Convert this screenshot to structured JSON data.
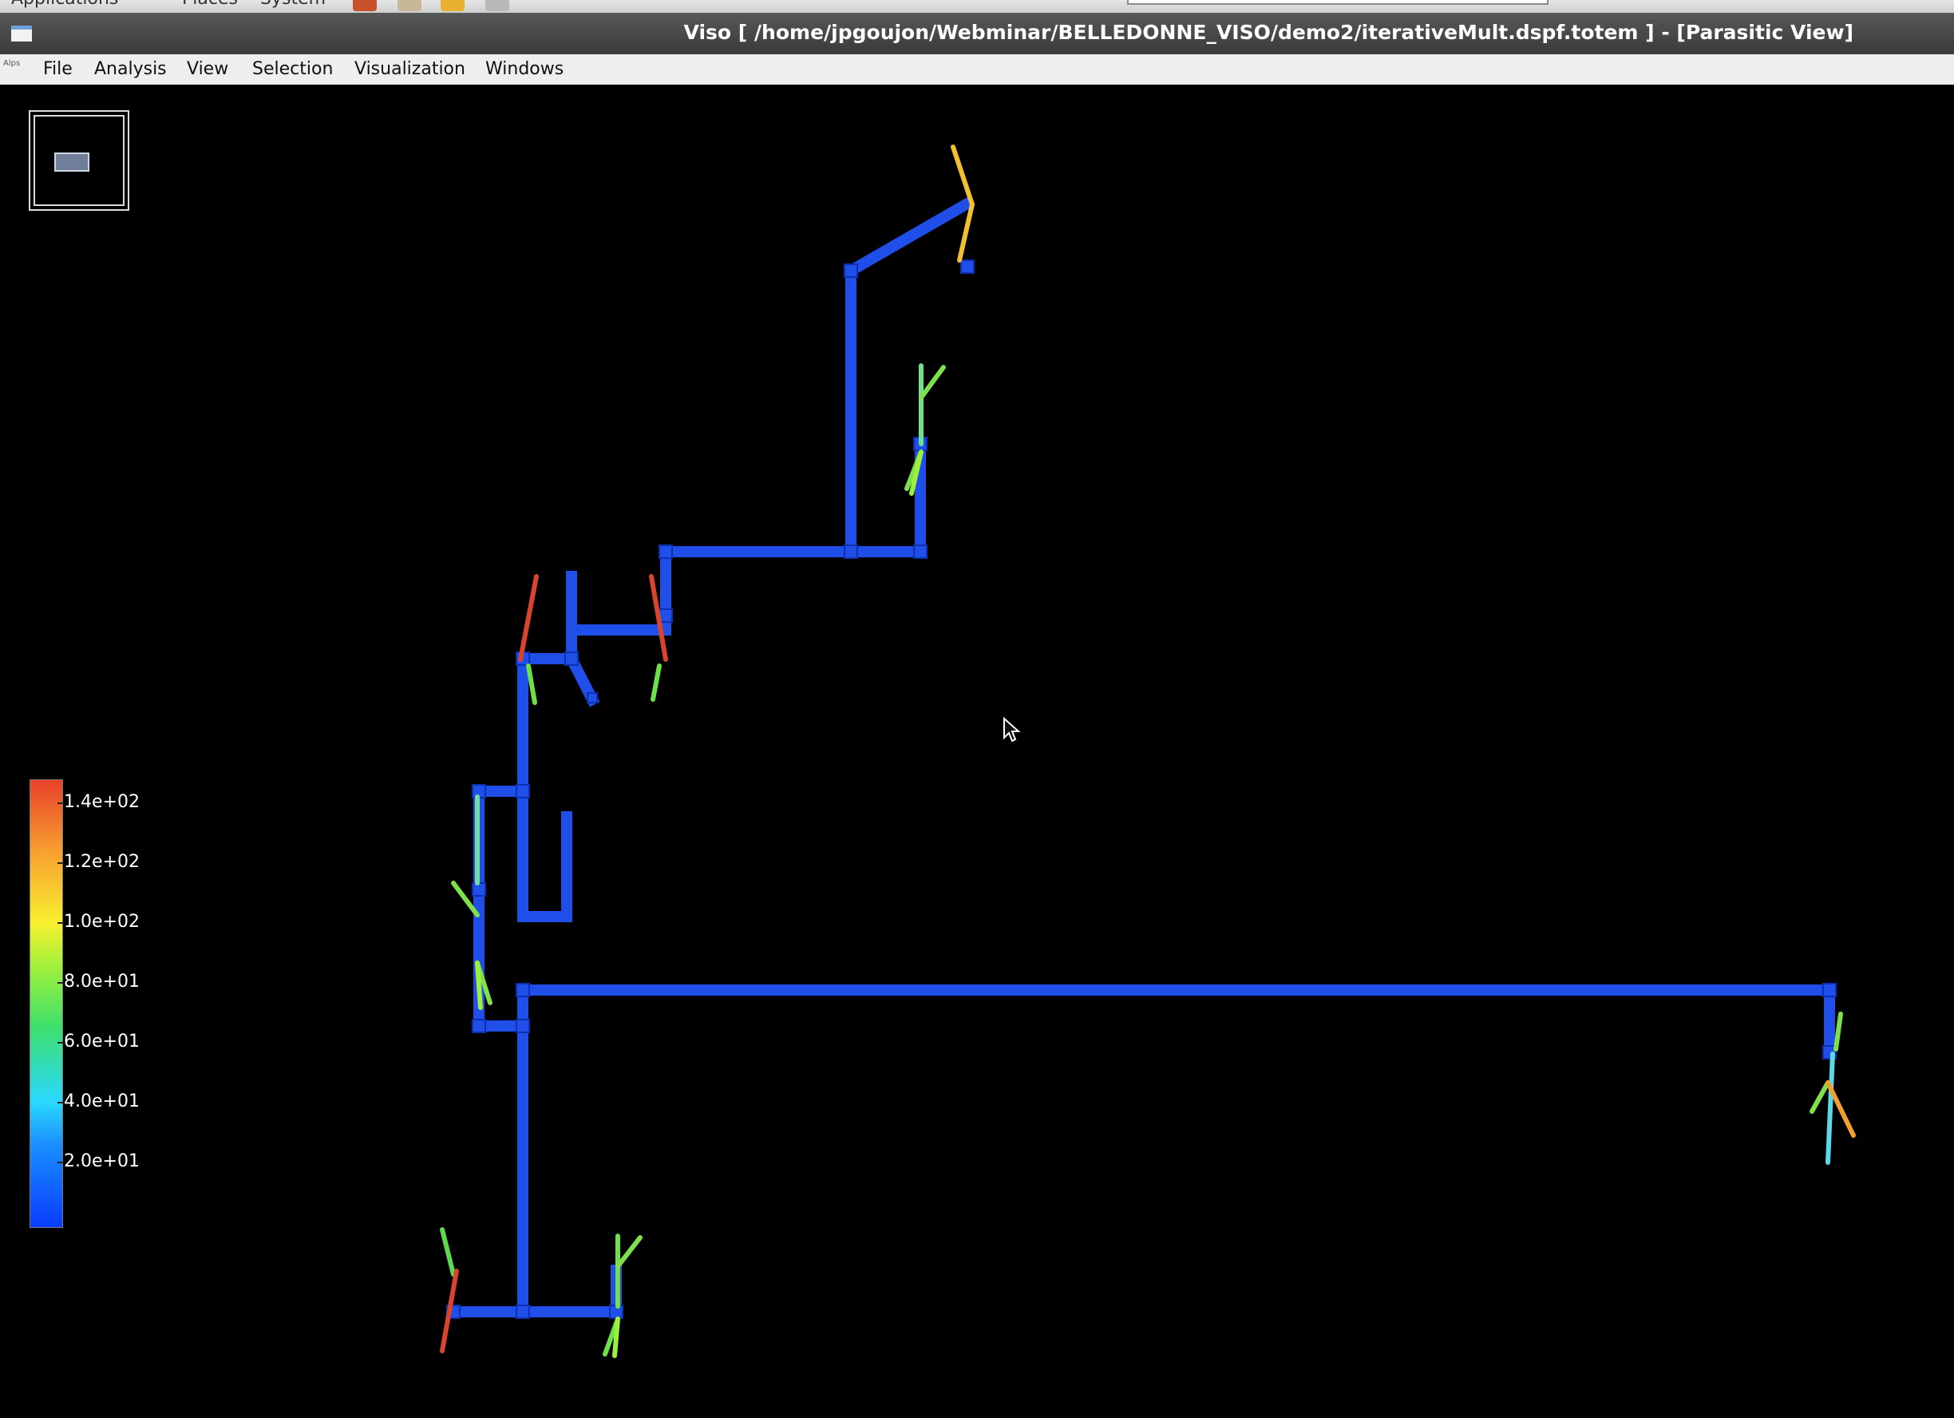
{
  "system_bar": {
    "items": [
      "Applications",
      "Places",
      "System"
    ]
  },
  "window": {
    "title": "Viso [ /home/jpgoujon/Webminar/BELLEDONNE_VISO/demo2/iterativeMult.dspf.totem ] - [Parasitic View]"
  },
  "menubar": {
    "grip_label": "Alps",
    "items": [
      "File",
      "Analysis",
      "View",
      "Selection",
      "Visualization",
      "Windows"
    ]
  },
  "legend": {
    "labels": [
      "1.4e+02",
      "1.2e+02",
      "1.0e+02",
      "8.0e+01",
      "6.0e+01",
      "4.0e+01",
      "2.0e+01"
    ]
  },
  "colors": {
    "wire": "#1f4fe8",
    "background": "#000000",
    "resistor_green": "#4ed04a",
    "resistor_red": "#d8442e",
    "resistor_yellow": "#f0c030"
  },
  "icons": [
    "window-icon",
    "overview-icon",
    "pointer-cursor-icon"
  ]
}
